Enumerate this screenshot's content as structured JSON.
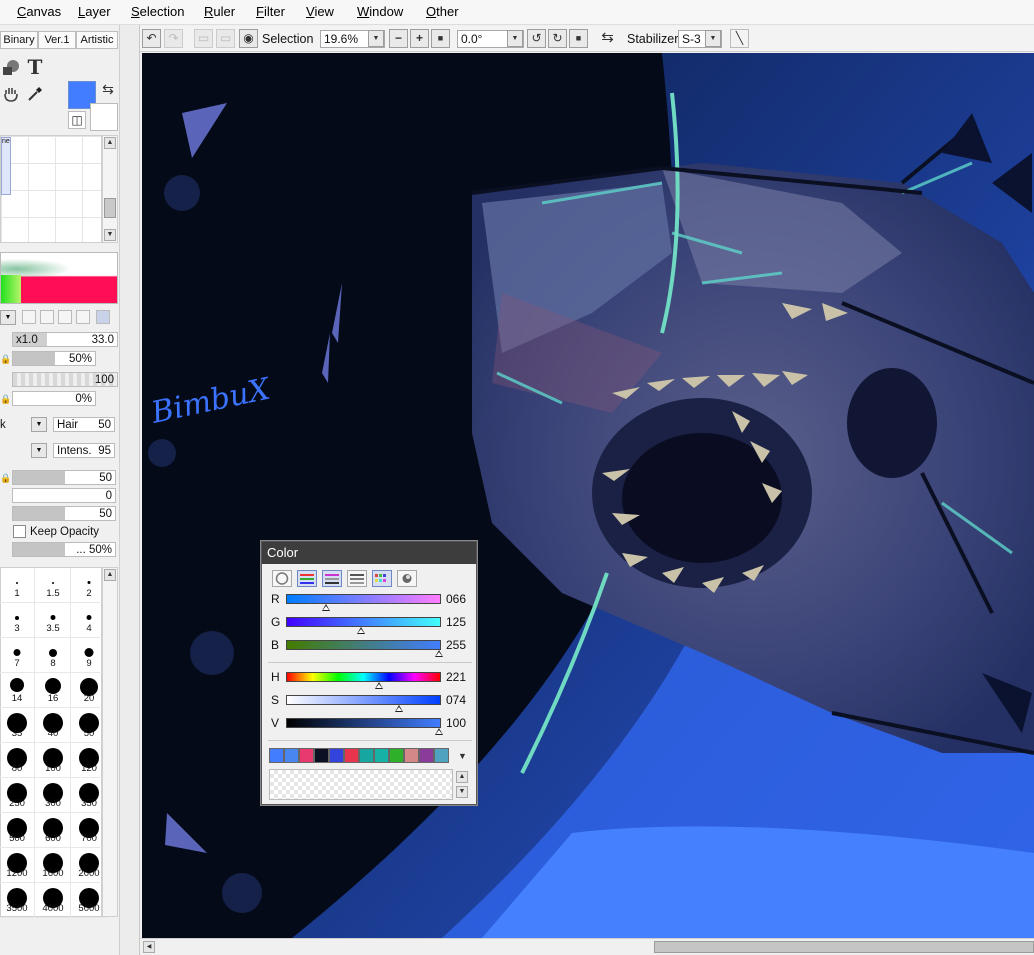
{
  "menu": [
    "Canvas",
    "Layer",
    "Selection",
    "Ruler",
    "Filter",
    "View",
    "Window",
    "Other"
  ],
  "left_panel": {
    "tabs": [
      "Binary",
      "Ver.1",
      "Artistic"
    ],
    "tool_label": "ne",
    "colors": {
      "foreground": "#427dff",
      "background": "#ffffff"
    },
    "size_multiplier": "x1.0",
    "size_value": "33.0",
    "min_size": "50%",
    "density": "100",
    "min_density": "0%",
    "blending_dropdown": "k",
    "texture_label": "Hair",
    "texture_value": "50",
    "intensity_label": "Intens.",
    "intensity_value": "95",
    "blending": "50",
    "dilution": "0",
    "persistence": "50",
    "keep_opacity_label": "Keep Opacity",
    "bottom_value": "... 50%",
    "brush_sizes": [
      "1",
      "1.5",
      "2",
      "3",
      "3.5",
      "4",
      "7",
      "8",
      "9",
      "14",
      "16",
      "20",
      "35",
      "40",
      "50",
      "80",
      "100",
      "120",
      "250",
      "300",
      "350",
      "500",
      "600",
      "700",
      "1200",
      "1600",
      "2000",
      "3500",
      "4000",
      "5000"
    ]
  },
  "toolbar": {
    "selection_label": "Selection",
    "zoom": "19.6%",
    "rotation": "0.0°",
    "stabilizer_label": "Stabilizer",
    "stabilizer_value": "S-3"
  },
  "canvas": {
    "signature": "BimbuX"
  },
  "color_panel": {
    "title": "Color",
    "rgb": [
      {
        "label": "R",
        "value": "066",
        "level": 0.26
      },
      {
        "label": "G",
        "value": "125",
        "level": 0.49
      },
      {
        "label": "B",
        "value": "255",
        "level": 1.0
      }
    ],
    "hsv": [
      {
        "label": "H",
        "value": "221",
        "level": 0.61
      },
      {
        "label": "S",
        "value": "074",
        "level": 0.74
      },
      {
        "label": "V",
        "value": "100",
        "level": 1.0
      }
    ],
    "swatches": [
      "#427dff",
      "#4a86f0",
      "#e83a6e",
      "#0b1022",
      "#3344dd",
      "#e8344c",
      "#18a6a0",
      "#16b2a6",
      "#2fb02a",
      "#d48888",
      "#8a3c9a",
      "#4fa3c0"
    ]
  }
}
